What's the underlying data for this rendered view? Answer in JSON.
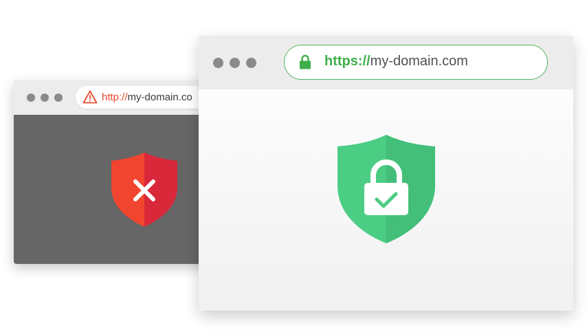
{
  "insecure_window": {
    "url_scheme": "http://",
    "url_host": "my-domain.co",
    "warning_icon": "warning-triangle-icon",
    "status_icon": "shield-x-icon"
  },
  "secure_window": {
    "url_scheme": "https://",
    "url_host": "my-domain.com",
    "lock_icon": "padlock-icon",
    "status_icon": "shield-lock-check-icon"
  },
  "colors": {
    "secure_green": "#3fae49",
    "shield_green_light": "#4bcd84",
    "shield_green_dark": "#43bf7a",
    "insecure_red": "#e84a2f",
    "shield_red_light": "#f2452f",
    "shield_red_dark": "#d9283a",
    "window_dots": "#8a8a8a",
    "titlebar": "#ececec",
    "insecure_body": "#666666"
  }
}
